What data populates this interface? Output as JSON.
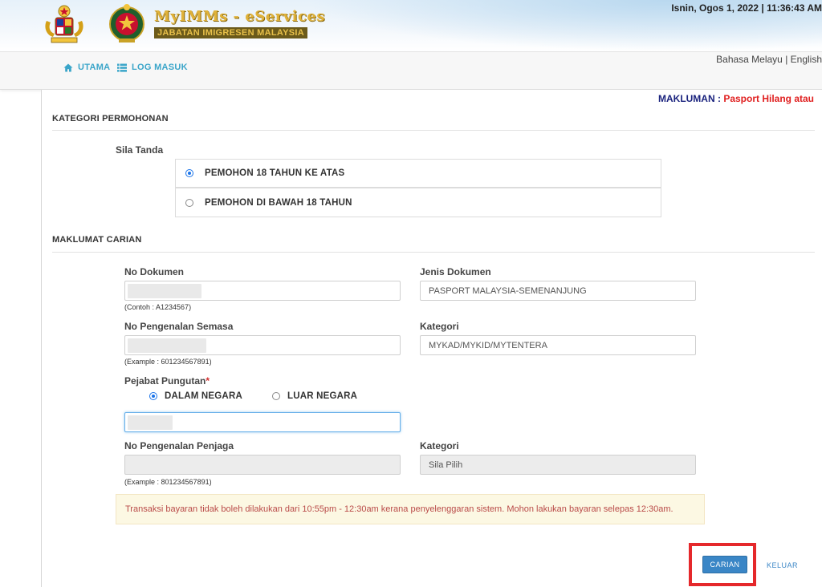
{
  "header": {
    "brand_title": "MyIMMs - eServices",
    "brand_subtitle": "JABATAN IMIGRESEN MALAYSIA",
    "datetime": "Isnin, Ogos 1, 2022 | 11:36:43 AM",
    "crest_icons": [
      "malaysia-coat-of-arms-icon",
      "immigration-emblem-icon"
    ]
  },
  "nav": {
    "home_label": "UTAMA",
    "home_icon": "home-icon",
    "login_label": "LOG MASUK",
    "login_icon": "list-icon",
    "language": "Bahasa Melayu | English"
  },
  "notice": {
    "label": "MAKLUMAN :",
    "text": "Pasport Hilang atau"
  },
  "category": {
    "section_title": "KATEGORI PERMOHONAN",
    "prompt": "Sila Tanda",
    "options": [
      {
        "label": "PEMOHON 18 TAHUN KE ATAS",
        "checked": true
      },
      {
        "label": "PEMOHON DI BAWAH 18 TAHUN",
        "checked": false
      }
    ]
  },
  "search": {
    "section_title": "MAKLUMAT CARIAN",
    "doc_no_label": "No Dokumen",
    "doc_no_hint": "(Contoh : A1234567)",
    "doc_type_label": "Jenis Dokumen",
    "doc_type_value": "PASPORT MALAYSIA-SEMENANJUNG",
    "id_no_label": "No Pengenalan Semasa",
    "id_no_hint": "(Example : 601234567891)",
    "category_label": "Kategori",
    "category_value": "MYKAD/MYKID/MYTENTERA",
    "office_label": "Pejabat Pungutan",
    "office_required": "*",
    "office_options": [
      {
        "label": "DALAM NEGARA",
        "checked": true
      },
      {
        "label": "LUAR NEGARA",
        "checked": false
      }
    ],
    "guardian_label": "No Pengenalan Penjaga",
    "guardian_hint": "(Example : 801234567891)",
    "guardian_category_label": "Kategori",
    "guardian_category_value": "Sila Pilih"
  },
  "alert_text": "Transaksi bayaran tidak boleh dilakukan dari 10:55pm - 12:30am kerana penyelenggaran sistem. Mohon lakukan bayaran selepas 12:30am.",
  "actions": {
    "search_button": "CARIAN",
    "exit_link": "KELUAR",
    "highlight_color": "#e5282b"
  },
  "colors": {
    "nav_link": "#3aa5c9",
    "notice_label": "#1a237e",
    "notice_text": "#e02020",
    "button": "#3a86c6",
    "alert_text": "#b94a48",
    "alert_bg": "#fcf8e3"
  }
}
